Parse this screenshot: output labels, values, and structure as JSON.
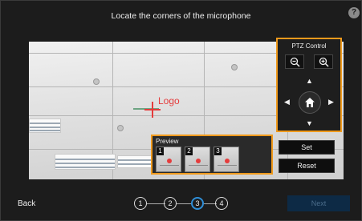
{
  "header": {
    "title": "Locate the corners of the microphone",
    "help_icon": "?"
  },
  "camera": {
    "target_label": "Logo"
  },
  "ptz": {
    "title": "PTZ Control",
    "zoom_out_icon": "zoom-out-icon",
    "zoom_in_icon": "zoom-in-icon",
    "up": "▲",
    "down": "▼",
    "left": "◀",
    "right": "▶",
    "home_icon": "home-icon"
  },
  "preview": {
    "title": "Preview",
    "thumbs": [
      {
        "num": "1"
      },
      {
        "num": "2"
      },
      {
        "num": "3"
      }
    ]
  },
  "actions": {
    "set_label": "Set",
    "reset_label": "Reset"
  },
  "footer": {
    "back_label": "Back",
    "steps": [
      "1",
      "2",
      "3",
      "4"
    ],
    "active_step": 3,
    "next_label": "Next"
  },
  "colors": {
    "accent": "#f09a1c",
    "active_step": "#2f8fd8",
    "marker": "#e53c3c"
  }
}
